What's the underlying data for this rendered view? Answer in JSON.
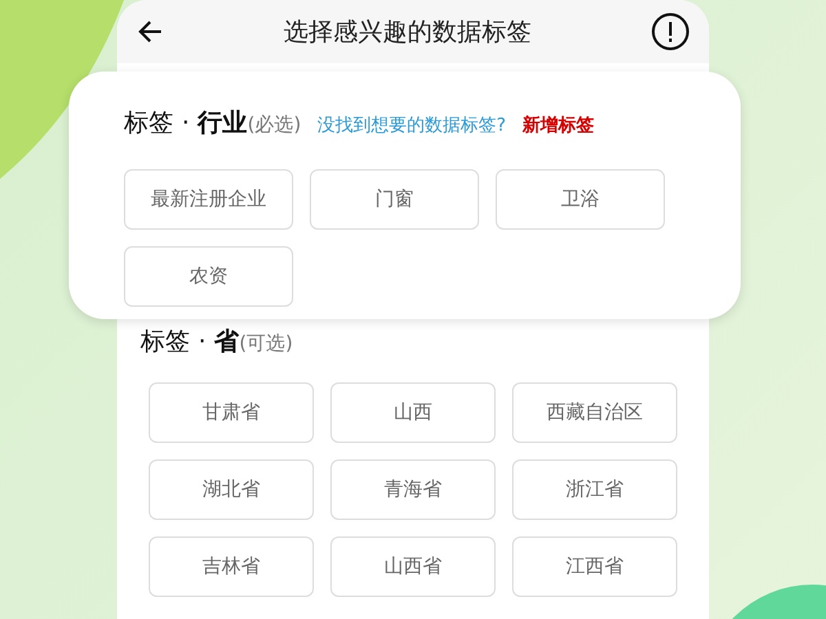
{
  "header": {
    "title": "选择感兴趣的数据标签"
  },
  "industry": {
    "prefix": "标签",
    "dot": "·",
    "name": "行业",
    "note": "(必选)",
    "link": "没找到想要的数据标签?",
    "add": "新增标签",
    "tags": [
      {
        "label": "最新注册企业"
      },
      {
        "label": "门窗"
      },
      {
        "label": "卫浴"
      },
      {
        "label": "农资"
      }
    ]
  },
  "province": {
    "prefix": "标签",
    "dot": "·",
    "name": "省",
    "note": "(可选)",
    "tags": [
      {
        "label": "甘肃省"
      },
      {
        "label": "山西"
      },
      {
        "label": "西藏自治区"
      },
      {
        "label": "湖北省"
      },
      {
        "label": "青海省"
      },
      {
        "label": "浙江省"
      },
      {
        "label": "吉林省"
      },
      {
        "label": "山西省"
      },
      {
        "label": "江西省"
      }
    ]
  }
}
